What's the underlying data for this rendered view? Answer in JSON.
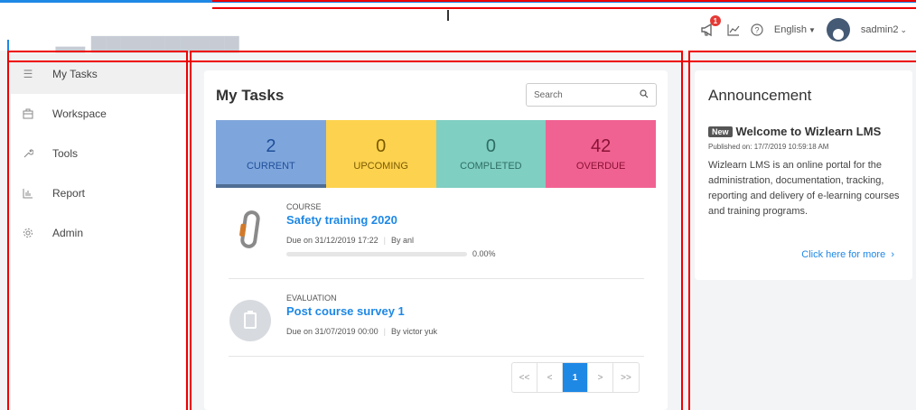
{
  "header": {
    "notification_count": "1",
    "language": "English",
    "username": "sadmin2"
  },
  "sidebar": {
    "items": [
      {
        "label": "My Tasks",
        "icon": "checklist-icon"
      },
      {
        "label": "Workspace",
        "icon": "briefcase-icon"
      },
      {
        "label": "Tools",
        "icon": "wrench-icon"
      },
      {
        "label": "Report",
        "icon": "bar-chart-icon"
      },
      {
        "label": "Admin",
        "icon": "gear-icon"
      }
    ]
  },
  "tasks_panel": {
    "title": "My Tasks",
    "search_placeholder": "Search",
    "stats": {
      "current": {
        "value": "2",
        "label": "CURRENT"
      },
      "upcoming": {
        "value": "0",
        "label": "UPCOMING"
      },
      "completed": {
        "value": "0",
        "label": "COMPLETED"
      },
      "overdue": {
        "value": "42",
        "label": "OVERDUE"
      }
    },
    "tasks": [
      {
        "type": "COURSE",
        "name": "Safety training 2020",
        "due": "Due on 31/12/2019 17:22",
        "by": "By anl",
        "progress_text": "0.00%",
        "progress": 0
      },
      {
        "type": "EVALUATION",
        "name": "Post course survey 1",
        "due": "Due on 31/07/2019 00:00",
        "by": "By victor yuk"
      }
    ],
    "pagination": {
      "first": "<<",
      "prev": "<",
      "current": "1",
      "next": ">",
      "last": ">>"
    }
  },
  "announcement": {
    "title": "Announcement",
    "badge": "New",
    "headline": "Welcome to Wizlearn LMS",
    "published": "Published on: 17/7/2019 10:59:18 AM",
    "body": "Wizlearn LMS is an online portal for the administration, documentation, tracking, reporting and delivery of e-learning courses and training programs.",
    "more_link": "Click here for more"
  },
  "colors": {
    "accent": "#1e88e5",
    "current": "#7fa6dc",
    "upcoming": "#fdd24e",
    "completed": "#7fcfc2",
    "overdue": "#f06292",
    "highlight_outline": "#e00000"
  }
}
